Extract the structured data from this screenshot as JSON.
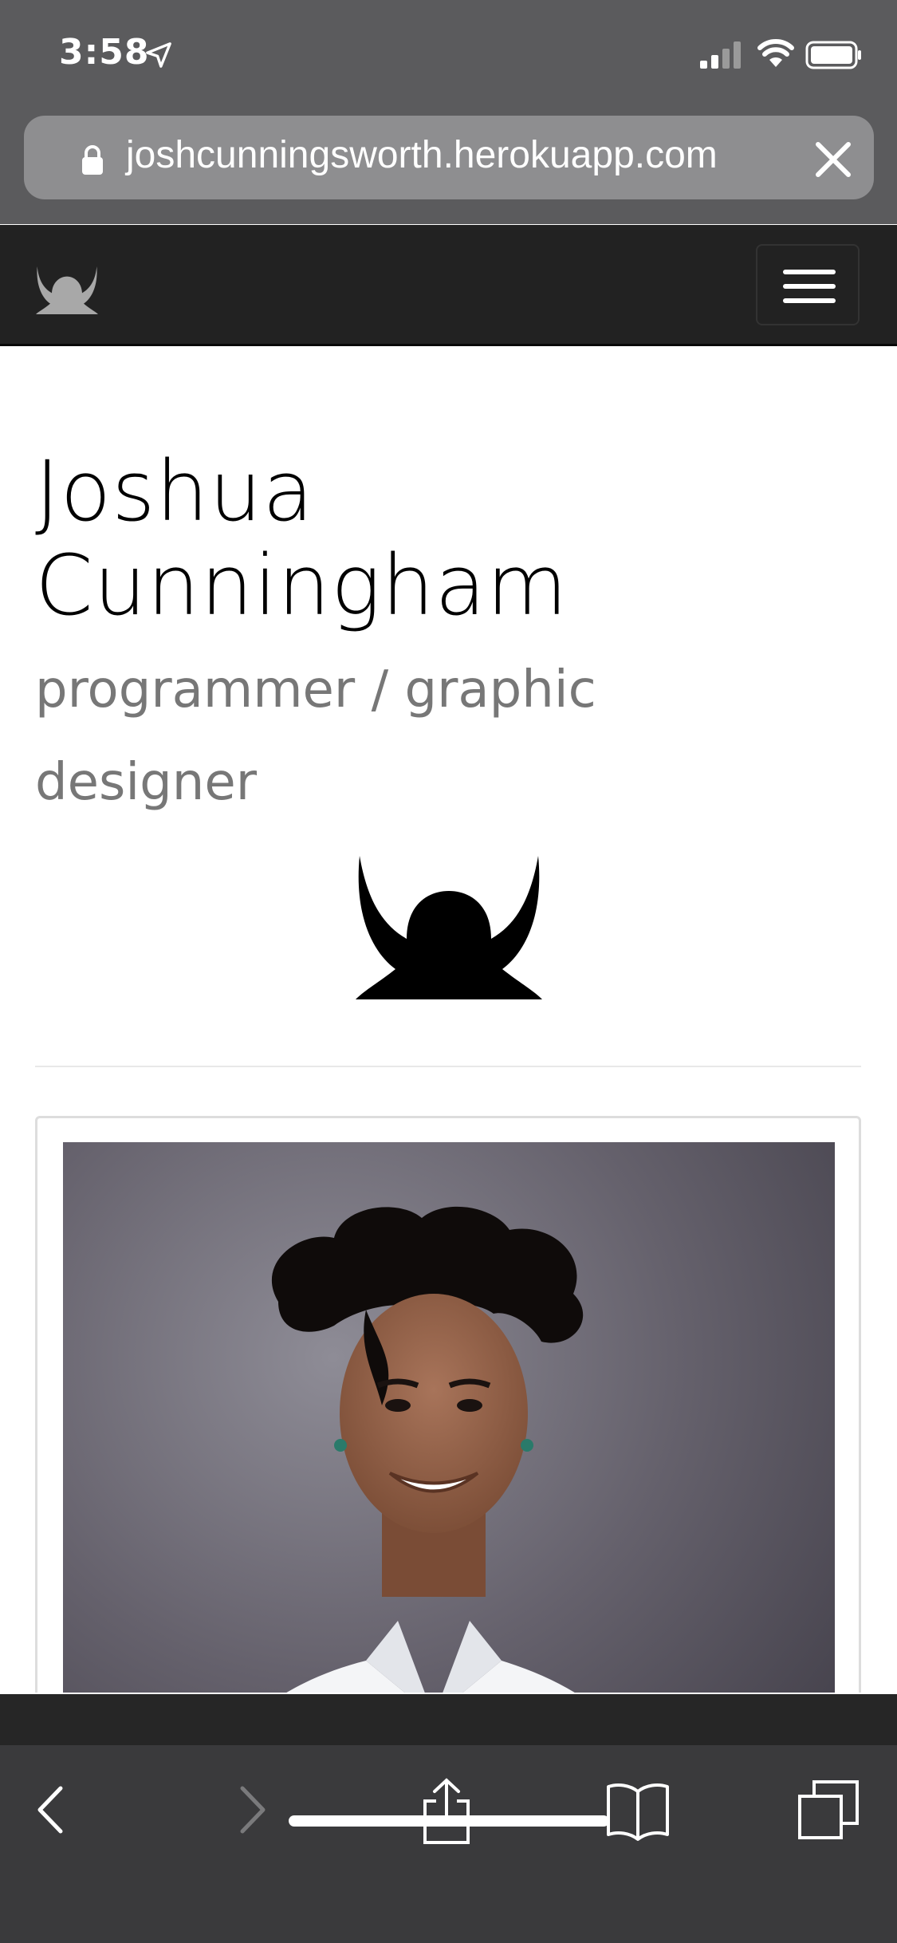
{
  "status_bar": {
    "time": "3:58"
  },
  "browser": {
    "url": "joshcunningsworth.herokuapp.com"
  },
  "profile": {
    "name": "Joshua Cunningham",
    "tagline": "programmer / graphic designer"
  },
  "icons": {
    "location": "location-arrow-icon",
    "signal": "cellular-signal-icon",
    "wifi": "wifi-icon",
    "battery": "battery-icon",
    "lock": "lock-icon",
    "close": "close-icon",
    "menu": "hamburger-menu-icon",
    "logo": "horned-helmet-logo",
    "back": "chevron-left-icon",
    "forward": "chevron-right-icon",
    "share": "share-icon",
    "bookmarks": "book-icon",
    "tabs": "tabs-icon"
  },
  "colors": {
    "chrome": "#5b5b5d",
    "navbar": "#222222",
    "tagline": "#777777"
  }
}
